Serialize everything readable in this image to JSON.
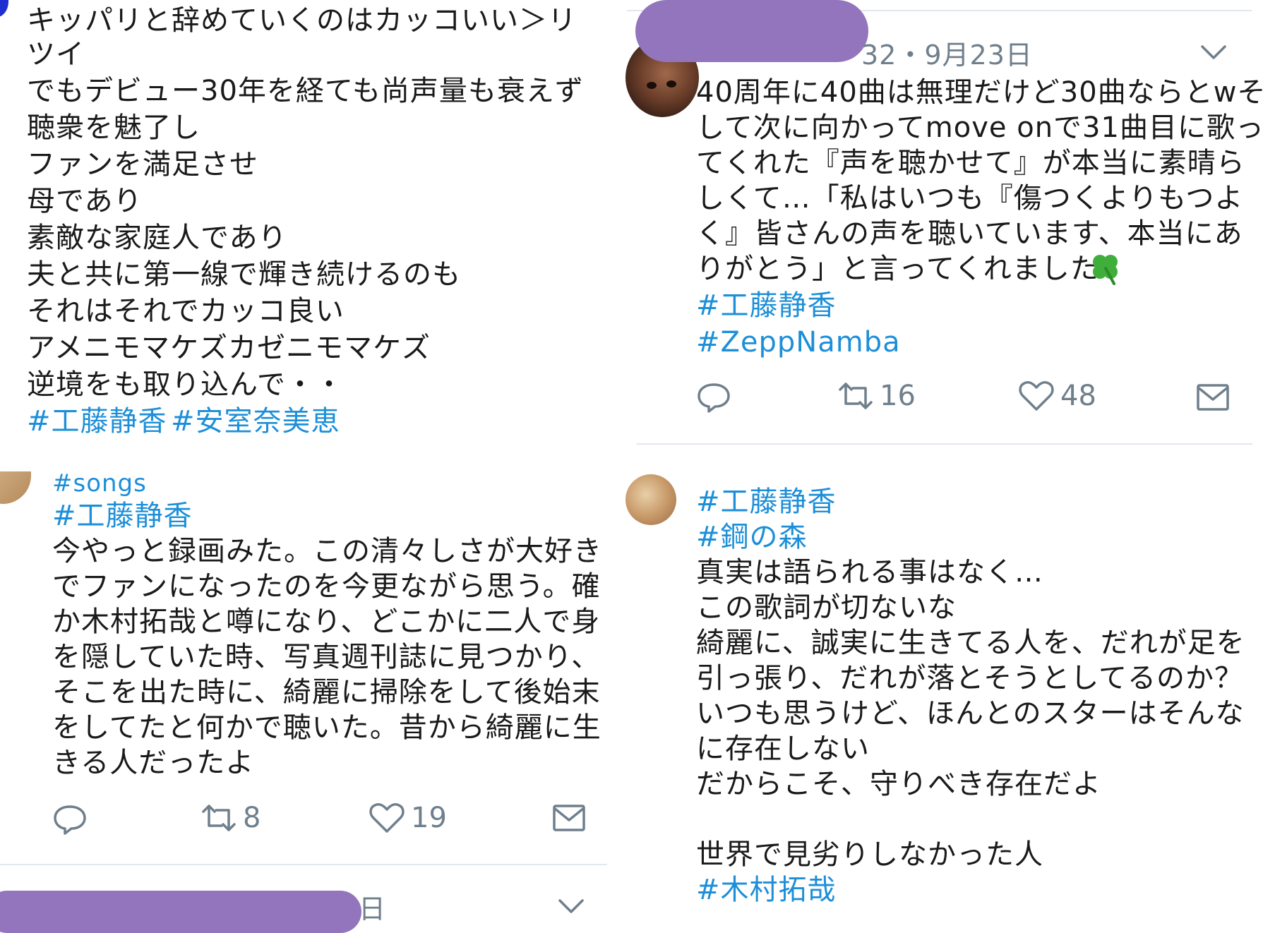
{
  "colors": {
    "hashtag": "#1d8fd8",
    "text": "#1a1a1a",
    "icon": "#6f7f8c",
    "redaction": "#9275bd",
    "divider": "#e1e8ed"
  },
  "left_column": {
    "tweet_top": {
      "lines": [
        "キッパリと辞めていくのはカッコいい＞リ",
        "ツイ",
        "でもデビュー30年を経ても尚声量も衰えず",
        "聴衆を魅了し",
        "ファンを満足させ",
        "母であり",
        "素敵な家庭人であり",
        "夫と共に第一線で輝き続けるのも",
        "それはそれでカッコ良い",
        "アメニモマケズカゼニモマケズ",
        "逆境をも取り込んで・・"
      ],
      "hashtags": [
        "#工藤静香",
        "#安室奈美恵"
      ]
    },
    "tweet_songs": {
      "hashtags": [
        "#songs",
        "#工藤静香"
      ],
      "lines": [
        "今やっと録画みた。この清々しさが大好き",
        "でファンになったのを今更ながら思う。確",
        "か木村拓哉と噂になり、どこかに二人で身",
        "を隠していた時、写真週刊誌に見つかり、",
        "そこを出た時に、綺麗に掃除をして後始末",
        "をしてたと何かで聴いた。昔から綺麗に生",
        "きる人だったよ"
      ],
      "actions": {
        "reply_icon": "reply-icon",
        "retweet_count": "8",
        "like_count": "19",
        "dm_icon": "mail-icon"
      }
    },
    "tweet_bottom_partial": {
      "date_fragment": "日",
      "menu_icon": "chevron-down-icon"
    }
  },
  "right_column": {
    "tweet_top": {
      "meta": "32・9月23日",
      "menu_icon": "chevron-down-icon",
      "lines": [
        "40周年に40曲は無理だけど30曲ならとwそ",
        "して次に向かってmove onで31曲目に歌っ",
        "てくれた『声を聴かせて』が本当に素晴ら",
        "しくて…「私はいつも『傷つくよりもつよ",
        "く』皆さんの声を聴いています、本当にあ",
        "りがとう」と言ってくれました"
      ],
      "emoji_icon": "four-leaf-clover-icon",
      "hashtags": [
        "#工藤静香",
        "#ZeppNamba"
      ],
      "actions": {
        "reply_icon": "reply-icon",
        "retweet_count": "16",
        "like_count": "48",
        "dm_icon": "mail-icon"
      }
    },
    "tweet_second": {
      "hashtags_top": [
        "#工藤静香",
        "#鋼の森"
      ],
      "lines": [
        "真実は語られる事はなく…",
        "この歌詞が切ないな",
        "綺麗に、誠実に生きてる人を、だれが足を",
        "引っ張り、だれが落とそうとしてるのか？",
        "いつも思うけど、ほんとのスターはそんな",
        "に存在しない",
        "だからこそ、守りべき存在だよ",
        "",
        "世界で見劣りしなかった人"
      ],
      "hashtag_bottom": "#木村拓哉"
    }
  }
}
